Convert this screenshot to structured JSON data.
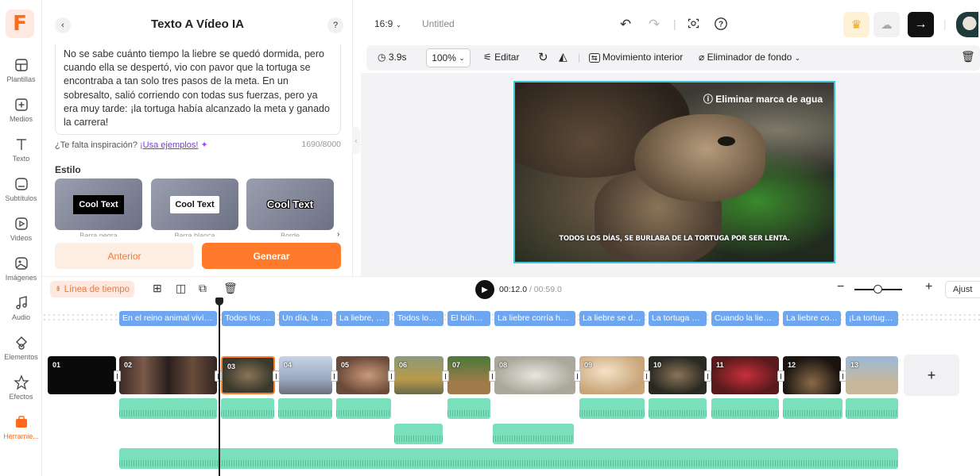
{
  "rail": {
    "items": [
      {
        "label": "Plantillas",
        "icon": "template-icon"
      },
      {
        "label": "Medios",
        "icon": "media-icon"
      },
      {
        "label": "Texto",
        "icon": "text-icon"
      },
      {
        "label": "Subtítulos",
        "icon": "subtitles-icon"
      },
      {
        "label": "Videos",
        "icon": "video-icon"
      },
      {
        "label": "Imágenes",
        "icon": "image-icon"
      },
      {
        "label": "Audio",
        "icon": "music-icon"
      },
      {
        "label": "Elementos",
        "icon": "shapes-icon"
      },
      {
        "label": "Efectos",
        "icon": "effects-icon"
      },
      {
        "label": "Herramie...",
        "icon": "toolbox-icon"
      }
    ]
  },
  "panel": {
    "title": "Texto A Vídeo IA",
    "back": "‹",
    "help": "?",
    "story": "No se sabe cuánto tiempo la liebre se quedó dormida, pero cuando ella se despertó, vio con pavor que la tortuga se encontraba a tan solo tres pasos de la meta. En un sobresalto, salió corriendo con todas sus fuerzas, pero ya era muy tarde: ¡la tortuga había alcanzado la meta y ganado la carrera!",
    "inspiration_q": "¿Te falta inspiración?",
    "inspiration_link": "¡Usa ejemplos!",
    "counter": "1690/8000",
    "style_heading": "Estilo",
    "styles": [
      {
        "text": "Cool Text",
        "caption": "Barra negra"
      },
      {
        "text": "Cool Text",
        "caption": "Barra blanca"
      },
      {
        "text": "Cool Text",
        "caption": "Borde"
      }
    ],
    "prev_label": "Anterior",
    "generate_label": "Generar"
  },
  "topbar": {
    "ratio": "16:9",
    "project_name": "Untitled"
  },
  "toolbar": {
    "duration": "3.9s",
    "zoom": "100%",
    "edit": "Editar",
    "motion": "Movimiento interior",
    "bg_remover": "Eliminador de fondo"
  },
  "preview": {
    "watermark": "Eliminar marca de agua",
    "subtitle": "TODOS LOS DÍAS, SE BURLABA DE LA TORTUGA POR SER LENTA."
  },
  "timeline": {
    "label": "Línea de tiempo",
    "current_time": "00:12.0",
    "total_time": "/ 00:59.0",
    "fit_label": "Ajust",
    "captions": [
      "En el reino animal vivía u...",
      "Todos los di...",
      "Un día, la tor...",
      "La liebre, as...",
      "Todos los ...",
      "El búho s...",
      "La liebre corría haci...",
      "La liebre se det...",
      "La tortuga se...",
      "Cuando la liebre...",
      "La liebre corri...",
      "¡La tortuga ..."
    ],
    "clips": [
      "01",
      "02",
      "03",
      "04",
      "05",
      "06",
      "07",
      "08",
      "09",
      "10",
      "11",
      "12",
      "13"
    ],
    "add_label": "+"
  },
  "colors": {
    "accent": "#ff7a2b",
    "caption_chip": "#6fa6f0",
    "audio": "#79e0bb",
    "preview_border": "#3ec4d8"
  }
}
